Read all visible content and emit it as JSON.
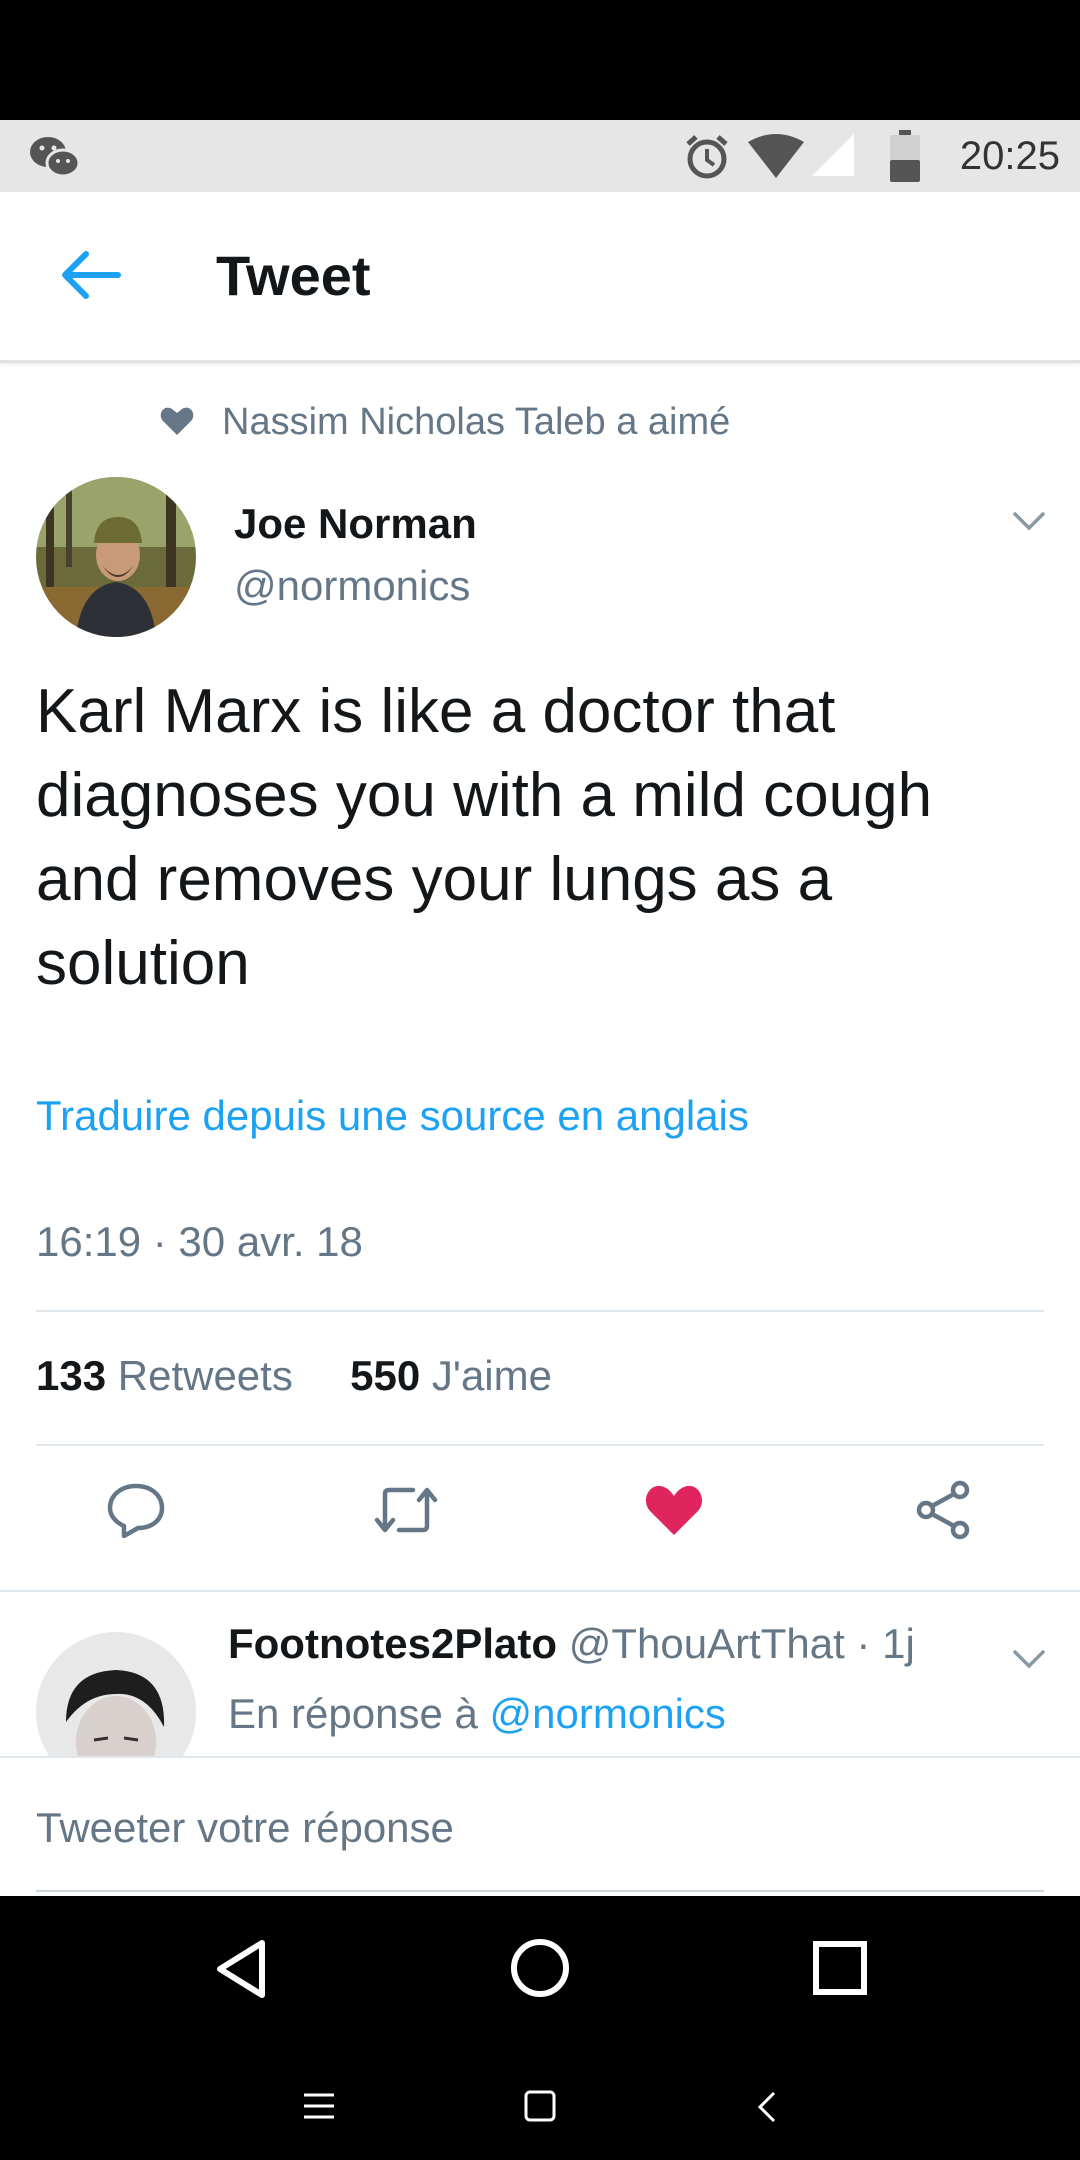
{
  "status_bar": {
    "time": "20:25",
    "icons": [
      "wechat-icon",
      "alarm-icon",
      "wifi-icon",
      "signal-icon",
      "battery-icon"
    ]
  },
  "header": {
    "title": "Tweet",
    "back_icon": "arrow-left-icon"
  },
  "liked_by": {
    "text": "Nassim Nicholas Taleb a aimé"
  },
  "tweet": {
    "name": "Joe Norman",
    "handle": "@normonics",
    "text": "Karl Marx is like a doctor that diagnoses you with a mild cough and removes your lungs as a solution",
    "translate": "Traduire depuis une source en anglais",
    "timestamp": "16:19 · 30 avr. 18",
    "retweets_count": "133",
    "retweets_label": "Retweets",
    "likes_count": "550",
    "likes_label": "J'aime"
  },
  "reply": {
    "name": "Footnotes2Plato",
    "handle_time": "@ThouArtThat · 1j",
    "prefix": "En réponse à",
    "mention": "@normonics"
  },
  "compose": {
    "placeholder": "Tweeter votre réponse"
  },
  "colors": {
    "accent": "#1da1f2",
    "like": "#e0245e",
    "muted": "#657786",
    "text": "#14171a"
  }
}
